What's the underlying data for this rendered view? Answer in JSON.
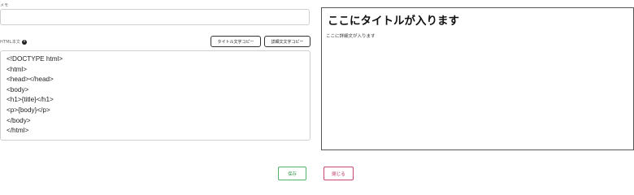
{
  "memo": {
    "label": "メモ",
    "value": ""
  },
  "html_section": {
    "label": "HTML本文",
    "info_glyph": "i",
    "copy_title_label": "タイトル文字コピー",
    "copy_detail_label": "詳細文文字コピー",
    "code_lines": [
      "<!DOCTYPE html>",
      "<html>",
      "<head></head>",
      "<body>",
      "<h1>{title}</h1>",
      "<p>{body}</p>",
      "</body>",
      "</html>"
    ]
  },
  "preview": {
    "title": "ここにタイトルが入ります",
    "body": "ここに詳細文が入ります"
  },
  "footer": {
    "save_label": "保存",
    "close_label": "閉じる"
  },
  "colors": {
    "save_accent": "#52b26a",
    "close_accent": "#c8456f"
  }
}
